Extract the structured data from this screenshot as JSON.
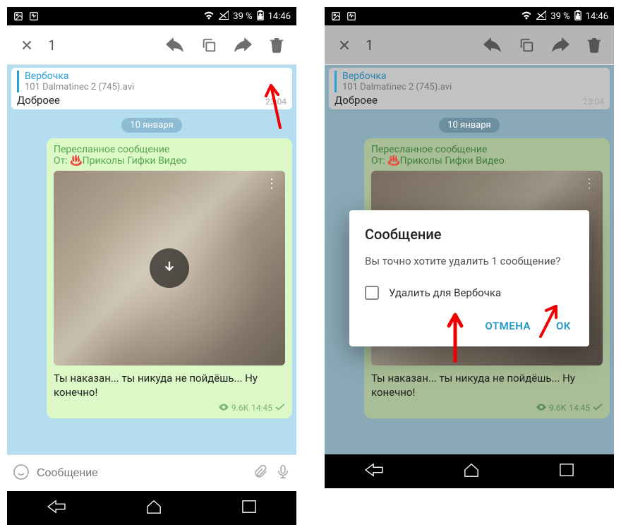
{
  "status": {
    "battery": "39 %",
    "time": "14:46"
  },
  "toolbar": {
    "count": "1"
  },
  "reply": {
    "name": "Вербочка",
    "file": "101 Dalmatinec 2 (745).avi",
    "text": "Доброее",
    "time": "23:04"
  },
  "date": "10 января",
  "message": {
    "fwd_label": "Пересланное сообщение",
    "fwd_from": "От: ♨️Приколы Гифки Видео",
    "caption": "Ты наказан... ты никуда не пойдёшь... Ну конечно!",
    "views": "9.6K",
    "time": "14:45"
  },
  "input": {
    "placeholder": "Сообщение"
  },
  "dialog": {
    "title": "Сообщение",
    "body": "Вы точно хотите удалить 1 сообщение?",
    "checkbox": "Удалить для Вербочка",
    "cancel": "ОТМЕНА",
    "ok": "ОК"
  }
}
